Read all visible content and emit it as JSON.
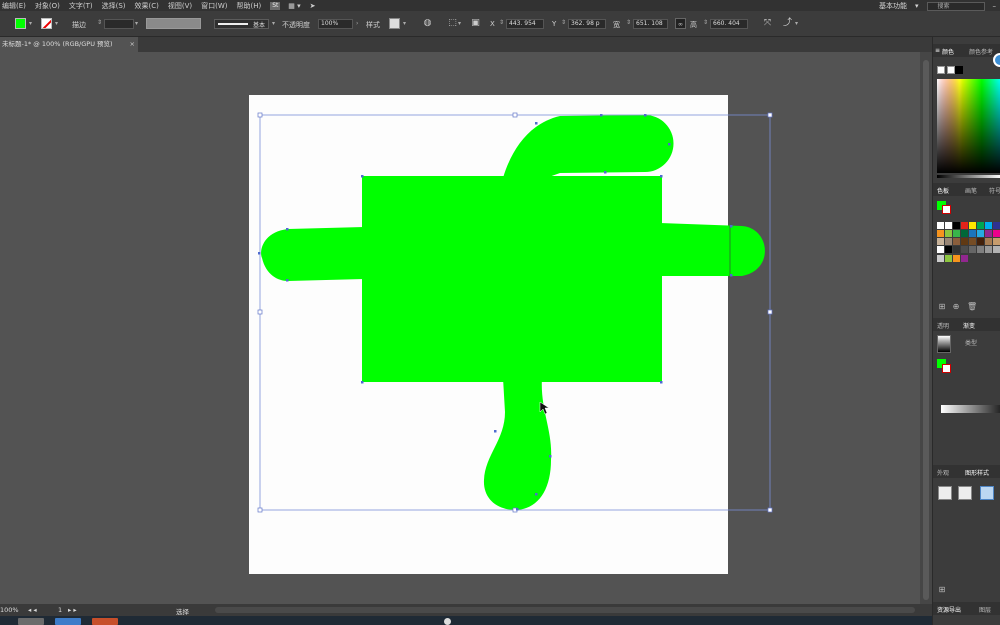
{
  "menu": {
    "items": [
      "编辑(E)",
      "对象(O)",
      "文字(T)",
      "选择(S)",
      "效果(C)",
      "视图(V)",
      "窗口(W)",
      "帮助(H)"
    ],
    "bridge_label": "St",
    "workspace": "基本功能",
    "search_placeholder": "搜索"
  },
  "control": {
    "fill_color": "#00ff00",
    "stroke_label": "描边",
    "stroke_profile": "基本",
    "opacity_label": "不透明度",
    "opacity_value": "100%",
    "style_label": "样式",
    "x_label": "X",
    "x_value": "443. 954",
    "y_label": "Y",
    "y_value": "362. 98 p",
    "w_label": "宽",
    "w_value": "651. 108",
    "h_label": "高",
    "h_value": "660. 404"
  },
  "document": {
    "tab_title": "未标题-1* @ 100% (RGB/GPU 预览)",
    "close_symbol": "×",
    "shape_color": "#00ff00"
  },
  "status": {
    "zoom": "100%",
    "page": "1",
    "tool": "选择"
  },
  "panels": {
    "color_tab": "颜色",
    "color_guide_tab": "颜色参考",
    "swatches_tab": "色板",
    "brushes_tab": "画笔",
    "symbols_tab": "符号",
    "transparency_tab": "透明",
    "gradient_tab": "渐变",
    "type_label": "类型",
    "align_tab": "外观",
    "graphic_styles_tab": "图形样式",
    "asset_export_tab": "资源导出",
    "layers_tab": "图层"
  }
}
